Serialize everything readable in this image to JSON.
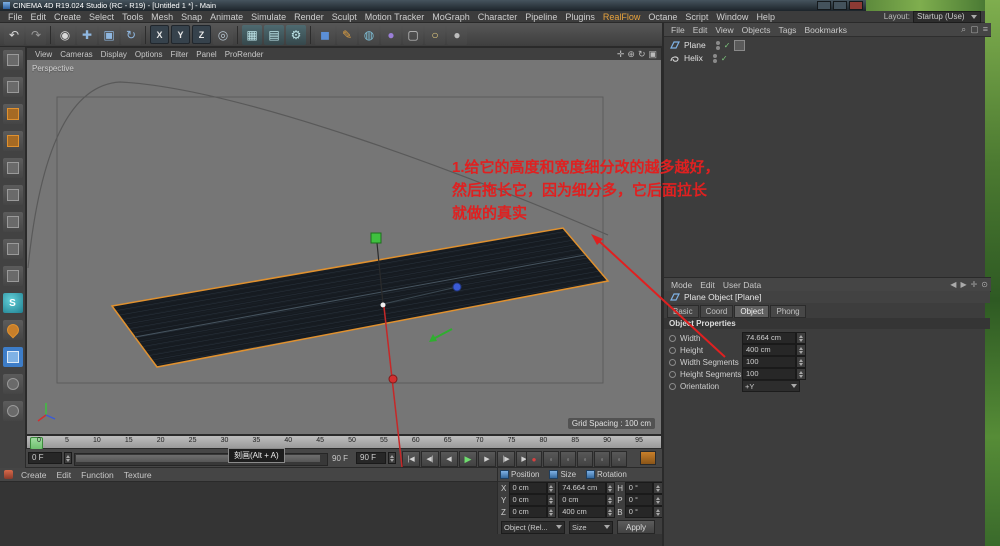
{
  "window": {
    "title": "CINEMA 4D R19.024 Studio (RC - R19) - [Untitled 1 *] - Main",
    "layout_label": "Layout:",
    "layout_value": "Startup (Use)"
  },
  "menubar": {
    "items": [
      "File",
      "Edit",
      "Create",
      "Select",
      "Tools",
      "Mesh",
      "Snap",
      "Animate",
      "Simulate",
      "Render",
      "Sculpt",
      "Motion Tracker",
      "MoGraph",
      "Character",
      "Pipeline",
      "Plugins",
      "RealFlow",
      "Octane",
      "Script",
      "Window",
      "Help"
    ]
  },
  "icons": {
    "undo": "↶",
    "redo": "↷",
    "live_selection": "◉",
    "move": "✚",
    "scale": "▣",
    "rotate": "↻",
    "axis_x": "X",
    "axis_y": "Y",
    "axis_z": "Z",
    "coord_system": "◎",
    "render_view": "▦",
    "picture_viewer": "▤",
    "render_settings": "⚙",
    "add_cube": "◼",
    "add_spline": "✎",
    "add_generator": "◍",
    "add_deformer": "●",
    "camera": "▢",
    "light": "○",
    "material": "●",
    "snap": "S",
    "check": "✓",
    "pan": "✛",
    "zoom": "⊕",
    "rotate_view": "↻",
    "toggle_view": "▣",
    "search": "⌕",
    "menu": "≡",
    "cam": "▢",
    "back": "◀",
    "fwd": "▶",
    "pin": "✛",
    "lock": "⊙"
  },
  "viewport": {
    "menu": [
      "View",
      "Cameras",
      "Display",
      "Options",
      "Filter",
      "Panel",
      "ProRender"
    ],
    "label": "Perspective",
    "grid_spacing": "Grid Spacing : 100 cm"
  },
  "annotation": {
    "lines": [
      "1.给它的高度和宽度细分改的越多越好，",
      "然后拖长它，因为细分多，它后面拉长",
      "就做的真实"
    ]
  },
  "tooltip": "刻画(Alt + A)",
  "timeline": {
    "ticks": [
      "0",
      "5",
      "10",
      "15",
      "20",
      "25",
      "30",
      "35",
      "40",
      "45",
      "50",
      "55",
      "60",
      "65",
      "70",
      "75",
      "80",
      "85",
      "90",
      "95"
    ],
    "current": "0 F",
    "range_end": "90 F",
    "end_field": "90 F"
  },
  "transport": {
    "buttons": [
      "|◀",
      "◀|",
      "◀",
      "▶",
      "▶",
      "|▶",
      "▶|"
    ],
    "keys": [
      "●",
      "◦",
      "◦",
      "◦",
      "◦",
      "◦"
    ]
  },
  "object_manager": {
    "menu": [
      "File",
      "Edit",
      "View",
      "Objects",
      "Tags",
      "Bookmarks"
    ],
    "objects": [
      {
        "name": "Plane"
      },
      {
        "name": "Helix"
      }
    ]
  },
  "attributes": {
    "menu": [
      "Mode",
      "Edit",
      "User Data"
    ],
    "title": "Plane Object [Plane]",
    "tabs": [
      "Basic",
      "Coord",
      "Object",
      "Phong"
    ],
    "active_tab": "Object",
    "section": "Object Properties",
    "rows": [
      {
        "label": "Width",
        "value": "74.664 cm"
      },
      {
        "label": "Height",
        "value": "400 cm"
      },
      {
        "label": "Width Segments",
        "value": "100"
      },
      {
        "label": "Height Segments",
        "value": "100"
      }
    ],
    "orientation_label": "Orientation",
    "orientation_value": "+Y"
  },
  "coordinates": {
    "headers": [
      "Position",
      "Size",
      "Rotation"
    ],
    "rows": [
      {
        "axis": "X",
        "position": "0 cm",
        "size": "74.664 cm",
        "rot_axis": "H",
        "rotation": "0 °"
      },
      {
        "axis": "Y",
        "position": "0 cm",
        "size": "0 cm",
        "rot_axis": "P",
        "rotation": "0 °"
      },
      {
        "axis": "Z",
        "position": "0 cm",
        "size": "400 cm",
        "rot_axis": "B",
        "rotation": "0 °"
      }
    ],
    "mode": "Object (Rel...",
    "size_mode": "Size",
    "apply": "Apply"
  },
  "materials": {
    "menu": [
      "Create",
      "Edit",
      "Function",
      "Texture"
    ]
  },
  "colors": {
    "accent_orange": "#e0912f",
    "annotation_red": "#e02020",
    "plane_fill": "#161b21",
    "timeline_marker_green": "#7ec97e"
  }
}
